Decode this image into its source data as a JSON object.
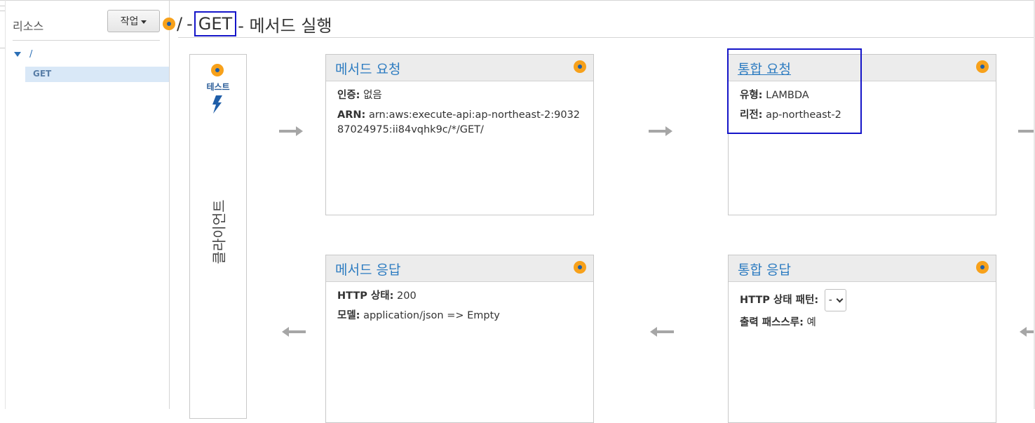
{
  "sidebar": {
    "title": "리소스",
    "action_button": "작업",
    "tree": {
      "root": "/",
      "selected_method": "GET"
    }
  },
  "header": {
    "path": "/",
    "sep1": "-",
    "method": "GET",
    "rest": "- 메서드 실행"
  },
  "client": {
    "test_label": "테스트",
    "label": "클라이언트"
  },
  "method_request": {
    "title": "메서드 요청",
    "auth_label": "인증:",
    "auth_value": "없음",
    "arn_label": "ARN:",
    "arn_value": "arn:aws:execute-api:ap-northeast-2:903287024975:ii84vqhk9c/*/GET/"
  },
  "integration_request": {
    "title": "통합 요청",
    "type_label": "유형:",
    "type_value": "LAMBDA",
    "region_label": "리전:",
    "region_value": "ap-northeast-2"
  },
  "method_response": {
    "title": "메서드 응답",
    "status_label": "HTTP 상태:",
    "status_value": "200",
    "model_label": "모델:",
    "model_value": "application/json => Empty"
  },
  "integration_response": {
    "title": "통합 응답",
    "pattern_label": "HTTP 상태 패턴:",
    "pattern_value": "-",
    "passthrough_label": "출력 패스스루:",
    "passthrough_value": "예"
  },
  "colors": {
    "accent_orange": "#f7a11b",
    "link_blue": "#2d7cc1",
    "highlight_box": "#1515c8"
  }
}
